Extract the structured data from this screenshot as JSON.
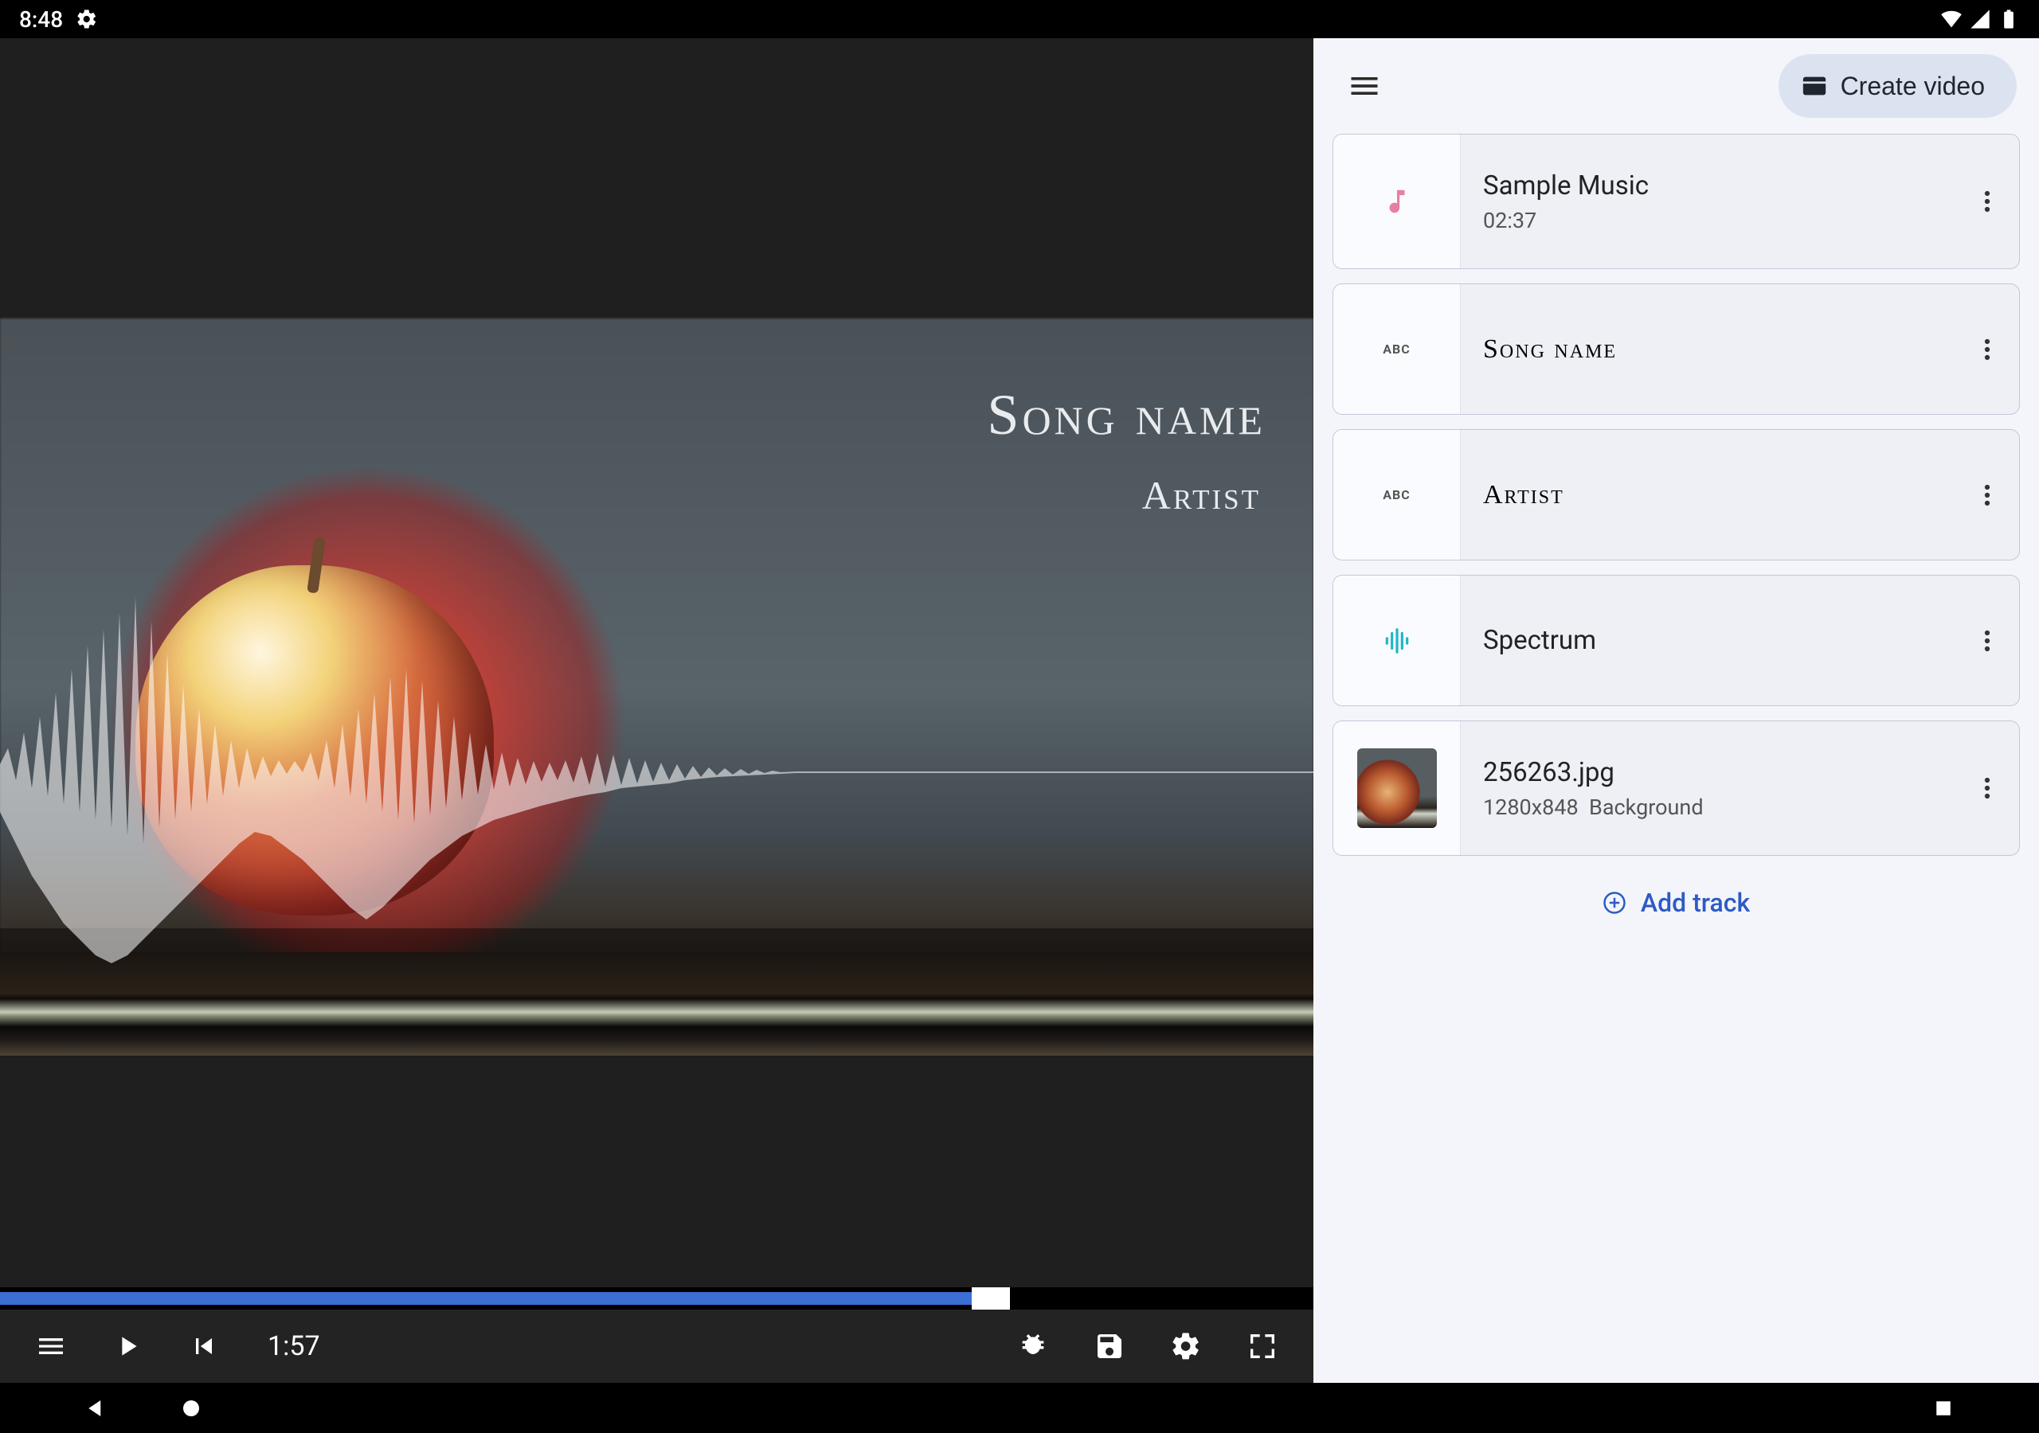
{
  "status": {
    "time": "8:48"
  },
  "preview": {
    "overlay": {
      "song": "Song name",
      "artist": "Artist"
    },
    "progress_percent": 74,
    "playback_time": "1:57"
  },
  "side": {
    "create_video_label": "Create video",
    "tracks": [
      {
        "kind": "music",
        "title": "Sample Music",
        "subtitle": "02:37"
      },
      {
        "kind": "text",
        "title": "Song name"
      },
      {
        "kind": "text",
        "title": "Artist"
      },
      {
        "kind": "spectrum",
        "title": "Spectrum"
      },
      {
        "kind": "image",
        "title": "256263.jpg",
        "dimensions": "1280x848",
        "role": "Background"
      }
    ],
    "add_track_label": "Add track"
  }
}
